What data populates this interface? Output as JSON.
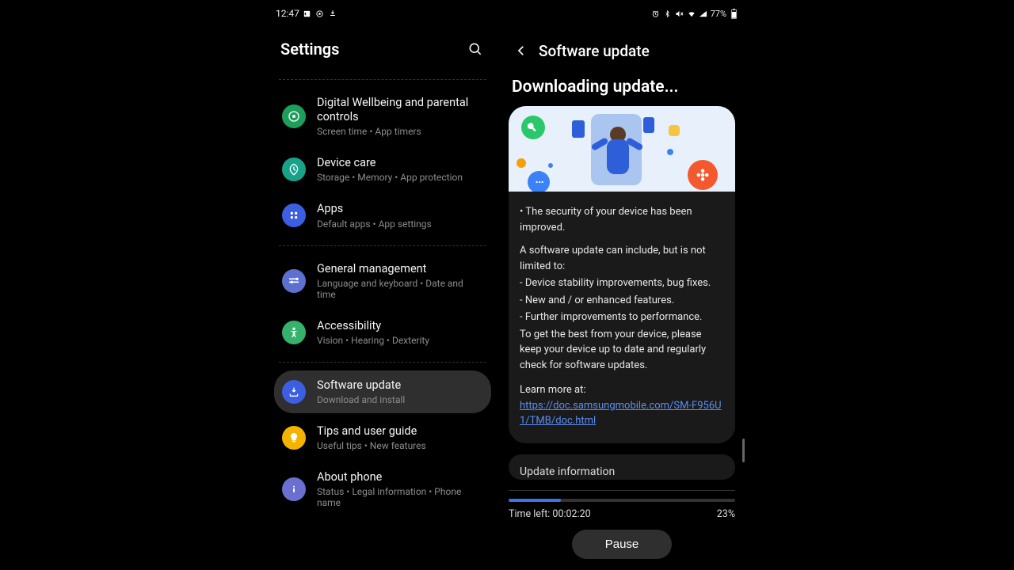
{
  "status": {
    "time": "12:47",
    "battery": "77%"
  },
  "left": {
    "title": "Settings",
    "items": [
      {
        "icon": "wellbeing",
        "color": "#1e9e5a",
        "title": "Digital Wellbeing and parental controls",
        "sub": "Screen time  •  App timers"
      },
      {
        "icon": "device-care",
        "color": "#18a28a",
        "title": "Device care",
        "sub": "Storage  •  Memory  •  App protection"
      },
      {
        "icon": "apps",
        "color": "#3b5fe0",
        "title": "Apps",
        "sub": "Default apps  •  App settings"
      }
    ],
    "items2": [
      {
        "icon": "general",
        "color": "#5d6fcf",
        "title": "General management",
        "sub": "Language and keyboard  •  Date and time"
      },
      {
        "icon": "accessibility",
        "color": "#36b36b",
        "title": "Accessibility",
        "sub": "Vision  •  Hearing  •  Dexterity"
      }
    ],
    "items3": [
      {
        "icon": "update",
        "color": "#3b5fe0",
        "title": "Software update",
        "sub": "Download and install",
        "selected": true
      },
      {
        "icon": "tips",
        "color": "#f5b301",
        "title": "Tips and user guide",
        "sub": "Useful tips  •  New features"
      },
      {
        "icon": "about",
        "color": "#6a6fd0",
        "title": "About phone",
        "sub": "Status  •  Legal information  •  Phone name"
      }
    ]
  },
  "right": {
    "title": "Software update",
    "heading": "Downloading update...",
    "bullet1": "• The security of your device has been improved.",
    "para1": "A software update can include, but is not limited to:",
    "line1": " - Device stability improvements, bug fixes.",
    "line2": " - New and / or enhanced features.",
    "line3": " - Further improvements to performance.",
    "para2": "To get the best from your device, please keep your device up to date and regularly check for software updates.",
    "learnLabel": "Learn more at:",
    "learnLink": "https://doc.samsungmobile.com/SM-F956U1/TMB/doc.html",
    "updateInfoTitle": "Update information",
    "timeLeft": "Time left: 00:02:20",
    "percent": "23%",
    "percentValue": 23,
    "pauseLabel": "Pause"
  }
}
